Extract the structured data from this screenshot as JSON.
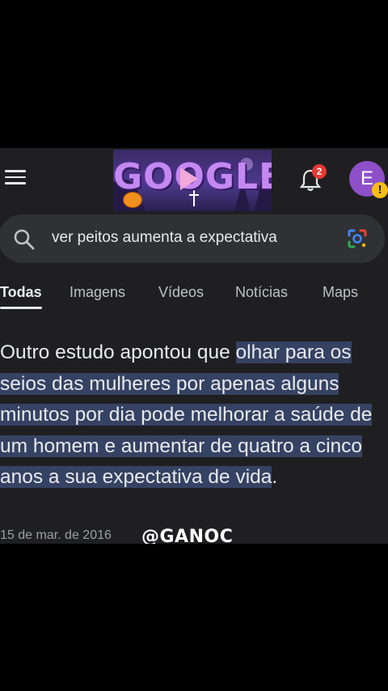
{
  "header": {
    "doodle_text": "GOOGLE",
    "notification_count": "2",
    "avatar_initial": "E",
    "avatar_alert": "!"
  },
  "search": {
    "query": "ver peitos aumenta a expectativa"
  },
  "tabs": [
    {
      "label": "Todas",
      "active": true
    },
    {
      "label": "Imagens"
    },
    {
      "label": "Vídeos"
    },
    {
      "label": "Notícias"
    },
    {
      "label": "Maps"
    }
  ],
  "snippet": {
    "text_plain": "Outro estudo apontou que ",
    "text_highlighted": "olhar para os seios das mulheres por apenas alguns minutos por dia pode melhorar a saúde de um homem e aumentar de quatro a cinco anos a sua expectativa de vida",
    "text_end": ".",
    "date": "15 de mar. de 2016"
  },
  "watermark": "@GANOC",
  "colors": {
    "background": "#1f1f21",
    "highlight": "#364263",
    "search_bar": "#303134",
    "avatar": "#8e4fc8",
    "badge": "#e53935"
  }
}
